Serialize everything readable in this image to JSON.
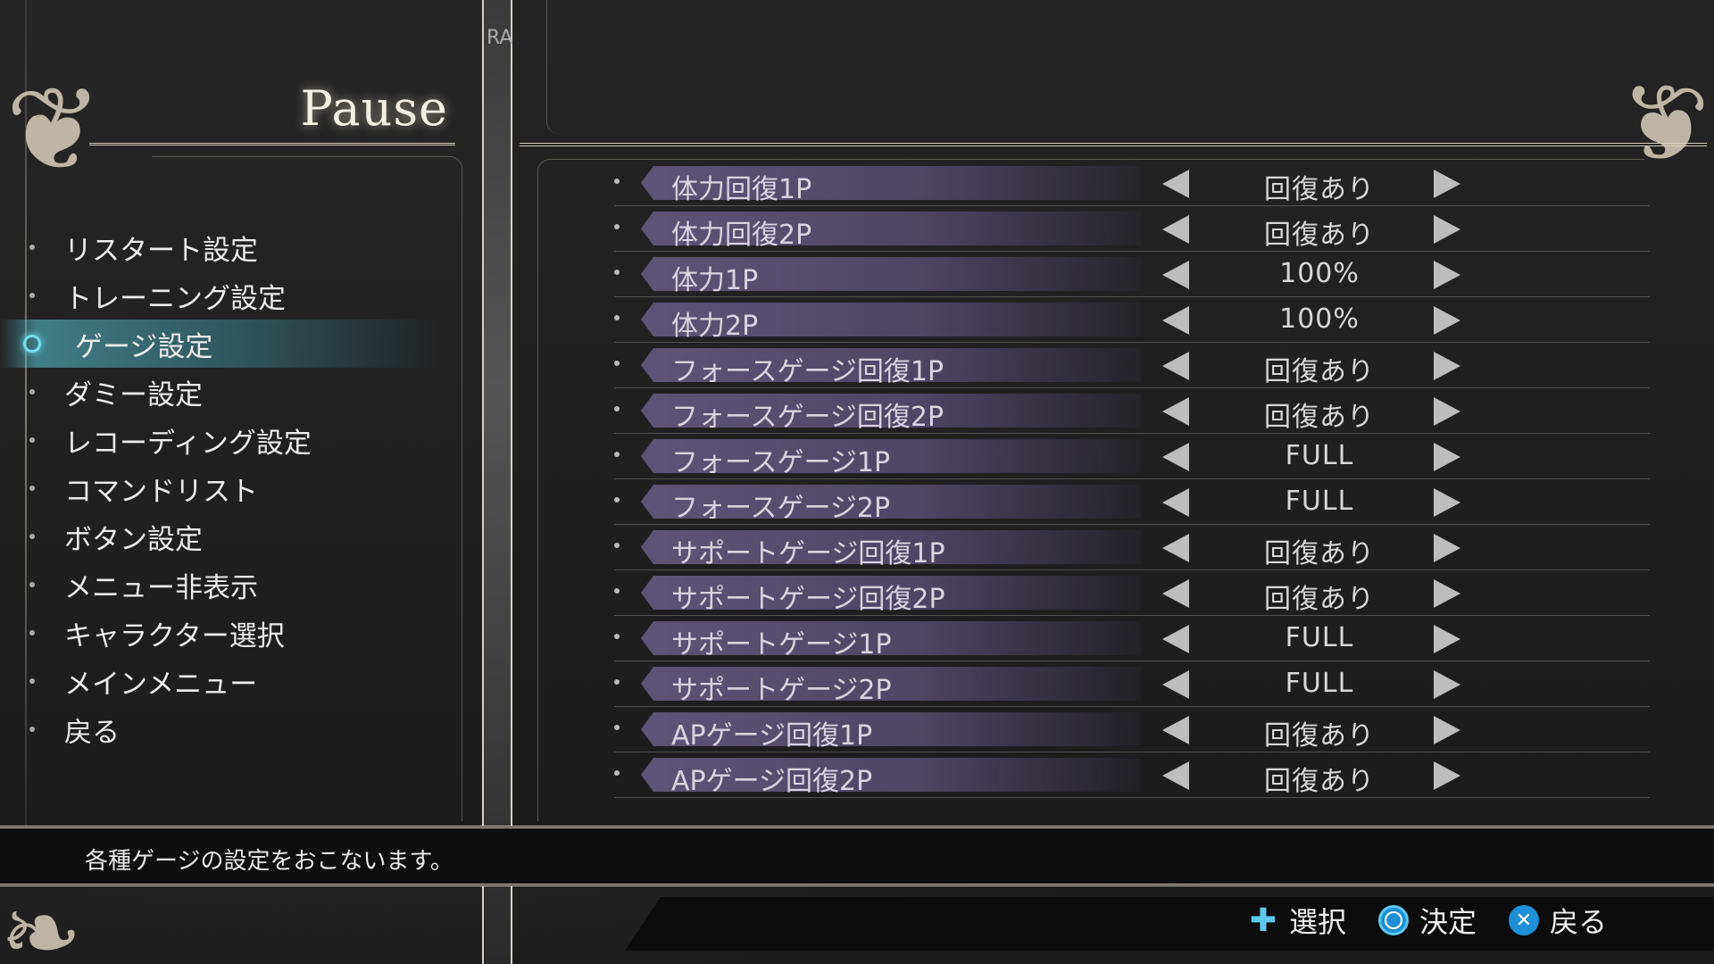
{
  "pause_title": "Pause",
  "strip_tag": "RA",
  "menu": {
    "items": [
      {
        "label": "リスタート設定",
        "active": false
      },
      {
        "label": "トレーニング設定",
        "active": false
      },
      {
        "label": "ゲージ設定",
        "active": true
      },
      {
        "label": "ダミー設定",
        "active": false
      },
      {
        "label": "レコーディング設定",
        "active": false
      },
      {
        "label": "コマンドリスト",
        "active": false
      },
      {
        "label": "ボタン設定",
        "active": false
      },
      {
        "label": "メニュー非表示",
        "active": false
      },
      {
        "label": "キャラクター選択",
        "active": false
      },
      {
        "label": "メインメニュー",
        "active": false
      },
      {
        "label": "戻る",
        "active": false
      }
    ]
  },
  "settings": [
    {
      "label": "体力回復1P",
      "value": "回復あり"
    },
    {
      "label": "体力回復2P",
      "value": "回復あり"
    },
    {
      "label": "体力1P",
      "value": "100%"
    },
    {
      "label": "体力2P",
      "value": "100%"
    },
    {
      "label": "フォースゲージ回復1P",
      "value": "回復あり"
    },
    {
      "label": "フォースゲージ回復2P",
      "value": "回復あり"
    },
    {
      "label": "フォースゲージ1P",
      "value": "FULL"
    },
    {
      "label": "フォースゲージ2P",
      "value": "FULL"
    },
    {
      "label": "サポートゲージ回復1P",
      "value": "回復あり"
    },
    {
      "label": "サポートゲージ回復2P",
      "value": "回復あり"
    },
    {
      "label": "サポートゲージ1P",
      "value": "FULL"
    },
    {
      "label": "サポートゲージ2P",
      "value": "FULL"
    },
    {
      "label": "APゲージ回復1P",
      "value": "回復あり"
    },
    {
      "label": "APゲージ回復2P",
      "value": "回復あり"
    }
  ],
  "description": "各種ゲージの設定をおこないます。",
  "controls": {
    "select": {
      "icon": "dpad-icon",
      "label": "選択"
    },
    "confirm": {
      "icon": "circle-button-icon",
      "label": "決定"
    },
    "back": {
      "icon": "cross-button-icon",
      "label": "戻る"
    }
  },
  "colors": {
    "accent": "#6fe0ee",
    "label_bar": "#5d5478",
    "button_blue": "#1d8fd6"
  }
}
